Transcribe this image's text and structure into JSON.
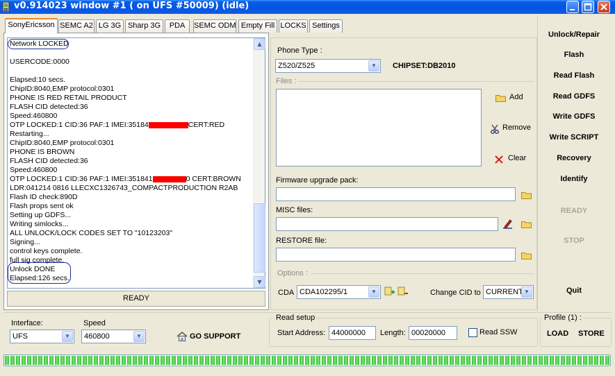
{
  "window": {
    "title": "v0.914023 window #1 ( on UFS #50009) (idle)"
  },
  "tabs": [
    {
      "label": "SonyEricsson",
      "active": true
    },
    {
      "label": "SEMC A2"
    },
    {
      "label": "LG 3G"
    },
    {
      "label": "Sharp 3G"
    },
    {
      "label": "PDA"
    },
    {
      "label": "SEMC ODM"
    },
    {
      "label": "Empty Fill"
    },
    {
      "label": "LOCKS"
    },
    {
      "label": "Settings"
    }
  ],
  "log": {
    "lines": [
      "Network LOCKED",
      "",
      "USERCODE:0000",
      "",
      "Elapsed:10 secs.",
      "ChipID:8040,EMP protocol:0301",
      "PHONE IS RED RETAIL PRODUCT",
      "FLASH CID detected:36",
      "Speed:460800",
      "OTP LOCKED:1 CID:36 PAF:1 IMEI:35184",
      "Restarting...",
      "ChipID:8040,EMP protocol:0301",
      "PHONE IS BROWN",
      "FLASH CID detected:36",
      "Speed:460800",
      "OTP LOCKED:1 CID:36 PAF:1 IMEI:351841",
      "LDR:041214 0816 LLECXC1326743_COMPACTPRODUCTION R2AB",
      "Flash ID check:890D",
      "Flash props sent ok",
      "Setting up GDFS...",
      "Writing simlocks...",
      "ALL UNLOCK/LOCK CODES SET TO \"10123203\"",
      "Signing...",
      "control keys complete.",
      "full sig complete.",
      "Unlock DONE",
      "Elapsed:126 secs."
    ],
    "tail_red": "CERT:RED",
    "tail_brown": "0 CERT:BROWN"
  },
  "status": "READY",
  "phone_type": {
    "label": "Phone Type :",
    "value": "Z520/Z525",
    "chipset": "CHIPSET:DB2010"
  },
  "files": {
    "label": "Files :",
    "add": "Add",
    "remove": "Remove",
    "clear": "Clear"
  },
  "firmware": {
    "label": "Firmware upgrade pack:",
    "value": ""
  },
  "misc": {
    "label": "MISC files:",
    "value": ""
  },
  "restore": {
    "label": "RESTORE file:",
    "value": ""
  },
  "options": {
    "label": "Options :",
    "cda_label": "CDA",
    "cda_value": "CDA102295/1",
    "change_cid_label": "Change CID to",
    "change_cid_value": "CURRENT"
  },
  "side_buttons": [
    {
      "label": "Unlock/Repair"
    },
    {
      "label": "Flash"
    },
    {
      "label": "Read Flash"
    },
    {
      "label": "Read GDFS"
    },
    {
      "label": "Write GDFS"
    },
    {
      "label": "Write SCRIPT"
    },
    {
      "label": "Recovery"
    },
    {
      "label": "Identify"
    }
  ],
  "side_status": {
    "ready": "READY",
    "stop": "STOP",
    "quit": "Quit"
  },
  "interface": {
    "label": "Interface:",
    "value": "UFS"
  },
  "speed": {
    "label": "Speed",
    "value": "460800"
  },
  "go_support": "GO SUPPORT",
  "read_setup": {
    "title": "Read setup",
    "start_label": "Start Address:",
    "start_value": "44000000",
    "length_label": "Length:",
    "length_value": "00020000",
    "ssw_label": "Read SSW"
  },
  "profile": {
    "title": "Profile (1) :",
    "load": "LOAD",
    "store": "STORE"
  },
  "progress": {
    "fraction": 1.0
  },
  "colors": {
    "titlebar": "#0554e0",
    "redaction": "#ff0000",
    "progress": "#2fbe2f",
    "oval": "#1c2f9c"
  }
}
